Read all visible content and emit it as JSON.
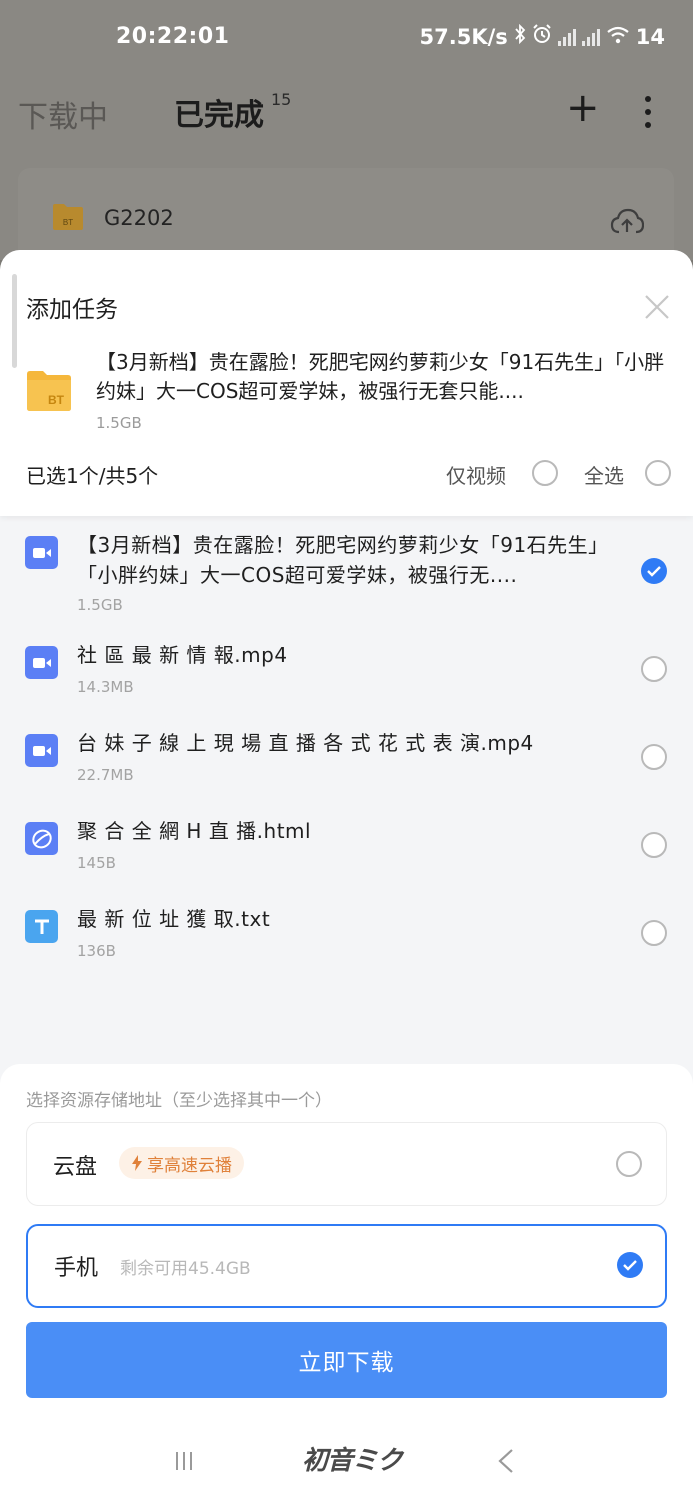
{
  "status_bar": {
    "time": "20:22:01",
    "speed": "57.5K/s",
    "battery": "14"
  },
  "background": {
    "tab_downloading": "下载中",
    "tab_completed": "已完成",
    "completed_count": "15",
    "row_name": "G2202",
    "folder_label": "BT"
  },
  "sheet": {
    "title": "添加任务",
    "task_name": "【3月新档】贵在露脸！死肥宅网约萝莉少女「91石先生」「小胖约妹」大一COS超可爱学妹，被强行无套只能....",
    "task_size": "1.5GB",
    "task_icon_label": "BT",
    "selected_count": "已选1个/共5个",
    "video_only_label": "仅视频",
    "select_all_label": "全选"
  },
  "files": [
    {
      "name": "【3月新档】贵在露脸！死肥宅网约萝莉少女「91石先生」「小胖约妹」大一COS超可爱学妹，被强行无....",
      "size": "1.5GB",
      "type": "video",
      "checked": true
    },
    {
      "name": "社 區 最 新 情 報.mp4",
      "size": "14.3MB",
      "type": "video",
      "checked": false
    },
    {
      "name": "台 妹 子 線 上 現 場 直 播 各 式 花 式 表 演.mp4",
      "size": "22.7MB",
      "type": "video",
      "checked": false
    },
    {
      "name": "聚 合 全 網 H 直 播.html",
      "size": "145B",
      "type": "html",
      "checked": false
    },
    {
      "name": "最 新 位 址 獲 取.txt",
      "size": "136B",
      "type": "text",
      "checked": false
    }
  ],
  "storage": {
    "label": "选择资源存储地址（至少选择其中一个）",
    "cloud_title": "云盘",
    "cloud_badge": "享高速云播",
    "phone_title": "手机",
    "phone_hint": "剩余可用45.4GB"
  },
  "download_button": "立即下载",
  "nav": {
    "home_label": "初音ミク"
  },
  "colors": {
    "accent": "#2f7bf5",
    "button": "#4a8ef6",
    "video_icon": "#5b7ff5",
    "html_icon": "#5b7ff5",
    "text_icon": "#4aa5ef",
    "folder": "#f5b73b",
    "badge_text": "#e0813a"
  }
}
